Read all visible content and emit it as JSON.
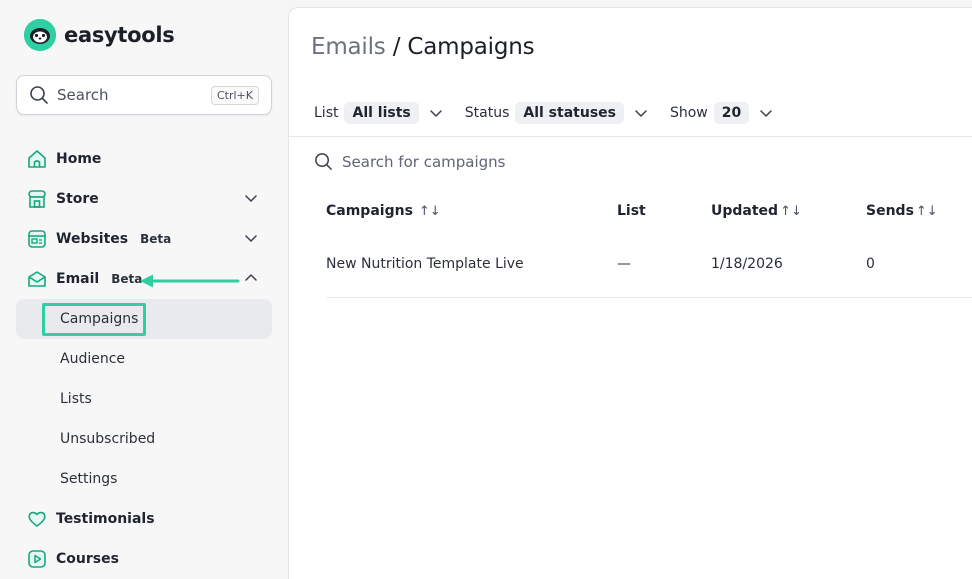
{
  "brand": {
    "name": "easytools",
    "accent": "#2fcfa3"
  },
  "search": {
    "label": "Search",
    "shortcut": "Ctrl+K"
  },
  "sidebar": {
    "items": [
      {
        "label": "Home",
        "icon": "home-icon"
      },
      {
        "label": "Store",
        "icon": "store-icon"
      },
      {
        "label": "Websites",
        "badge": "Beta",
        "icon": "website-icon"
      },
      {
        "label": "Email",
        "badge": "Beta",
        "icon": "email-icon"
      },
      {
        "label": "Testimonials",
        "icon": "heart-icon"
      },
      {
        "label": "Courses",
        "icon": "play-icon"
      }
    ],
    "email_subitems": [
      {
        "label": "Campaigns",
        "active": true
      },
      {
        "label": "Audience"
      },
      {
        "label": "Lists"
      },
      {
        "label": "Unsubscribed"
      },
      {
        "label": "Settings"
      }
    ]
  },
  "main": {
    "breadcrumb": "Emails",
    "separator": " / ",
    "title": "Campaigns",
    "filters": [
      {
        "label": "List",
        "value": "All lists"
      },
      {
        "label": "Status",
        "value": "All statuses"
      },
      {
        "label": "Show",
        "value": "20"
      }
    ],
    "campaign_search_placeholder": "Search for campaigns",
    "table": {
      "columns": [
        "Campaigns",
        "List",
        "Updated",
        "Sends"
      ],
      "sort_glyph": "↑↓",
      "rows": [
        {
          "campaign": "New Nutrition Template Live",
          "list": "—",
          "updated": "1/18/2026",
          "sends": "0"
        }
      ]
    }
  }
}
